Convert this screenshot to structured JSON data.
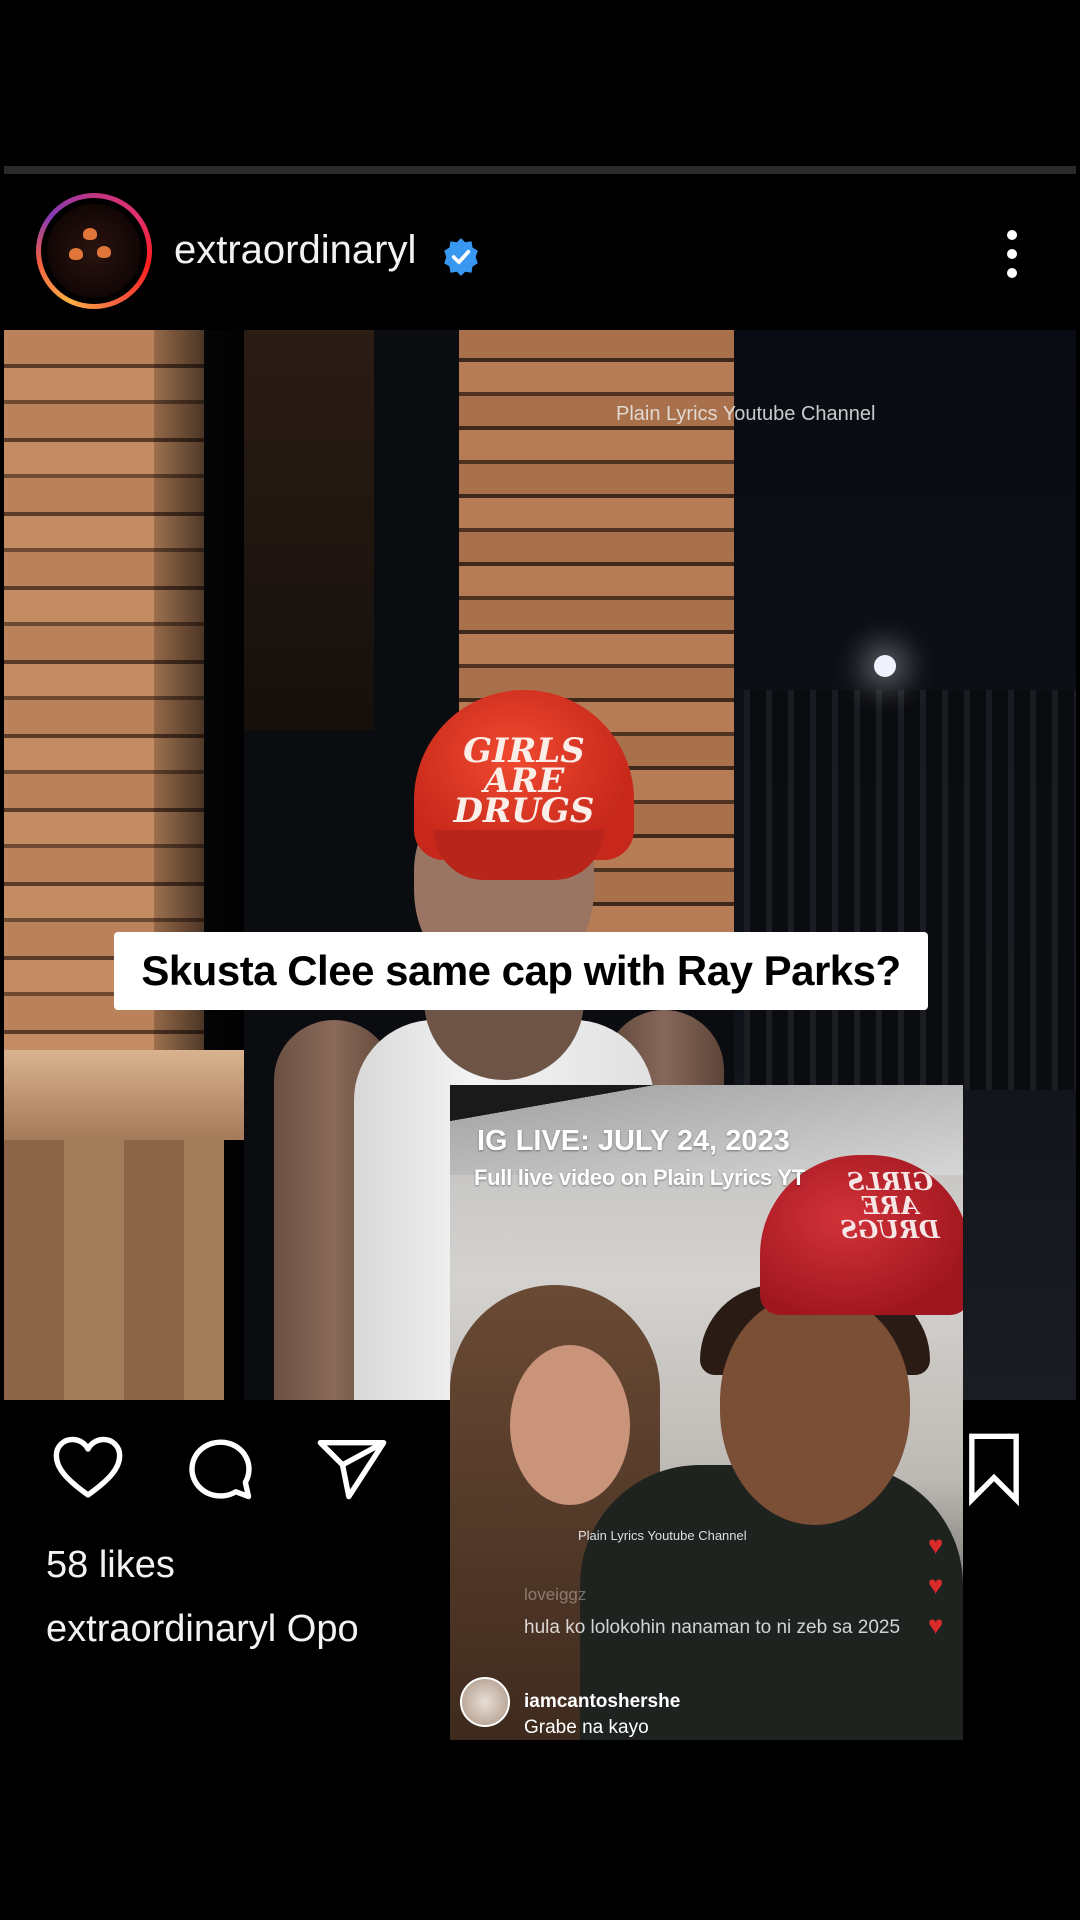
{
  "post": {
    "username": "extraordinaryl",
    "verified": true,
    "more_icon": "more-vertical-icon",
    "image": {
      "watermark": "Plain Lyrics Youtube Channel",
      "cap_text": "GIRLS ARE DRUGS",
      "overlay_caption": "Skusta Clee same cap with Ray Parks?"
    },
    "actions": {
      "like_icon": "heart-icon",
      "comment_icon": "comment-icon",
      "share_icon": "send-icon",
      "save_icon": "bookmark-icon"
    },
    "likes_label": "58 likes",
    "caption_user": "extraordinaryl",
    "caption_text": "Opo"
  },
  "live_clip": {
    "title": "IG LIVE: JULY 24, 2023",
    "subtitle": "Full live video on Plain Lyrics YT",
    "watermark": "Plain Lyrics Youtube Channel",
    "cap_text": "GIRLS ARE DRUGS",
    "comments": [
      {
        "user": "loveiggz",
        "text": "hula ko lolokohin nanaman to ni zeb sa 2025"
      },
      {
        "user": "iamcantoshershe",
        "text": "Grabe na kayo"
      }
    ],
    "reactions": "heart-icon"
  },
  "colors": {
    "background": "#000000",
    "verified_blue": "#3897f0",
    "cap_red": "#d8321f",
    "heart_red": "#d92a2a"
  }
}
